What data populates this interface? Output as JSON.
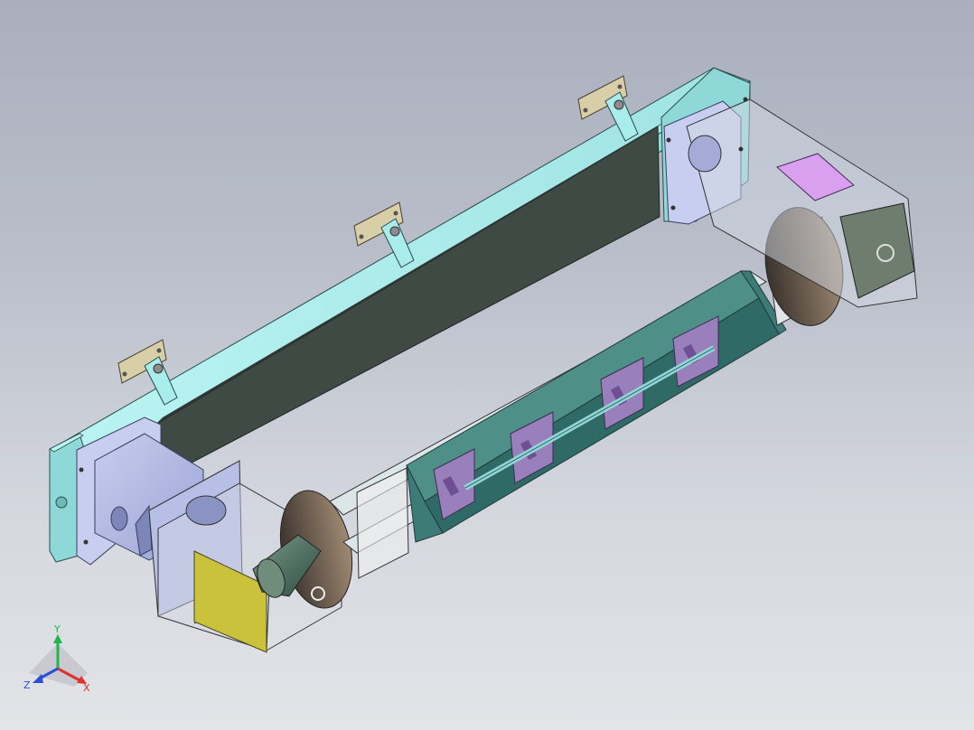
{
  "scene": {
    "background_top": "#a9afbd",
    "background_bottom": "#e2e4e8",
    "part_colors": {
      "beam": "#a8ecec",
      "panel": "#3f4a45",
      "housing": "#b7bfe6",
      "plate_purple": "#9a7fbd",
      "yellow_pad": "#c9c23a",
      "pink_pad": "#d9a0f0",
      "bracket": "#d8cfa8",
      "disk": "#7a6a5a",
      "green_steel": "#4e8f88"
    }
  },
  "triad": {
    "x_label": "X",
    "y_label": "Y",
    "z_label": "Z",
    "x_color": "#e03030",
    "y_color": "#22b34a",
    "z_color": "#2a4fd6"
  }
}
